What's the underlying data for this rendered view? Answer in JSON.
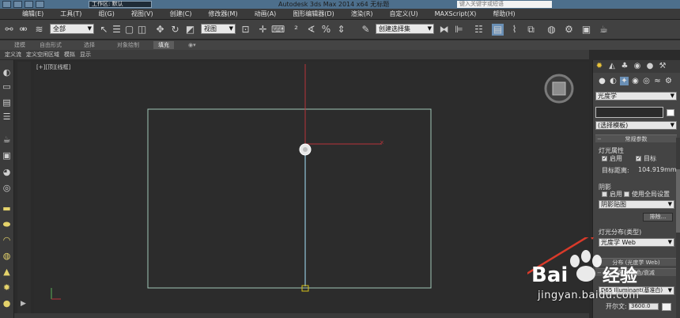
{
  "app": {
    "title": "Autodesk 3ds Max  2014 x64    无标题",
    "workspace": "工作区: 默认",
    "search_placeholder": "键入关键字或短语"
  },
  "menu": [
    "编辑(E)",
    "工具(T)",
    "组(G)",
    "视图(V)",
    "创建(C)",
    "修改器(M)",
    "动画(A)",
    "图形编辑器(D)",
    "渲染(R)",
    "自定义(U)",
    "MAXScript(X)",
    "帮助(H)"
  ],
  "toolbar": {
    "selection_filter": "全部",
    "reference_coord": "视图",
    "named_selection": "创建选择集"
  },
  "ribbon": {
    "tabs": [
      "建模",
      "自由形式",
      "选择",
      "对象绘制",
      "填充"
    ],
    "active_tab": "填充"
  },
  "subbar": [
    "定义流",
    "定义空闲区域",
    "模拟",
    "显示"
  ],
  "viewport": {
    "label": "[+][顶][线框]"
  },
  "panel": {
    "category": "光度学",
    "template": "(选择模板)",
    "rollout_params": "常规参数",
    "light_props_title": "灯光属性",
    "enable_label": "启用",
    "target_label": "目标",
    "target_distance_label": "目标距离:",
    "target_distance_value": "104.919mm",
    "shadows_title": "阴影",
    "shadows_enable_label": "启用",
    "global_settings_label": "使用全局设置",
    "shadow_type": "阴影贴图",
    "exclude_button": "排除...",
    "distribution_title": "灯光分布(类型)",
    "distribution_value": "光度学 Web",
    "rollout_web": "分布 (光度学 Web)",
    "rollout_intensity": "强度/颜色/衰减",
    "preset_value": "D65 Illuminant(基准白)",
    "kelvin_label": "开尔文:",
    "kelvin_value": "3600.0"
  },
  "watermark": {
    "brand": "Bai",
    "brand2": "经验",
    "url": "jingyan.baidu.com"
  },
  "colors": {
    "viewport_bg": "#2c2c2c",
    "rect_outline": "#9fc6b6",
    "axis_red": "#b8343a",
    "axis_blue": "#7fa7b8",
    "target_yellow": "#d6c21a",
    "annotation_arrow": "#d93a2a"
  }
}
